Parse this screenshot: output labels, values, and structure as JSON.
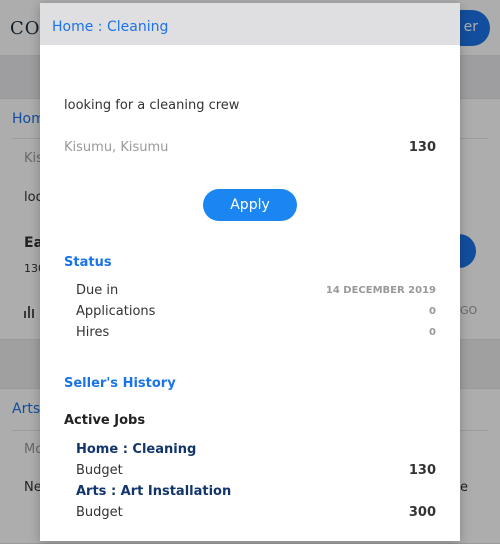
{
  "background": {
    "logo": "CO",
    "top_button": "er",
    "card1": {
      "title": "Home",
      "location": "Kis",
      "description": "loo",
      "headline": "Ea",
      "sub": "130",
      "go": "GO"
    },
    "card2": {
      "title": "Arts",
      "line1": "Mo",
      "line2": "Ne",
      "line2_right": "e"
    }
  },
  "modal": {
    "title": "Home : Cleaning",
    "description": "looking for a cleaning crew",
    "location": "Kisumu, Kisumu",
    "location_value": "130",
    "apply_label": "Apply",
    "status": {
      "title": "Status",
      "rows": [
        {
          "label": "Due in",
          "value": "14 DECEMBER 2019"
        },
        {
          "label": "Applications",
          "value": "0"
        },
        {
          "label": "Hires",
          "value": "0"
        }
      ]
    },
    "seller_history": {
      "title": "Seller's History",
      "active_jobs_label": "Active Jobs",
      "jobs": [
        {
          "title": "Home : Cleaning",
          "budget_label": "Budget",
          "budget": "130"
        },
        {
          "title": "Arts : Art Installation",
          "budget_label": "Budget",
          "budget": "300"
        }
      ]
    }
  },
  "colors": {
    "accent": "#1b73e8",
    "apply_button": "#1b86f2",
    "job_link": "#12366b",
    "header_bg": "#dfdfe2"
  }
}
